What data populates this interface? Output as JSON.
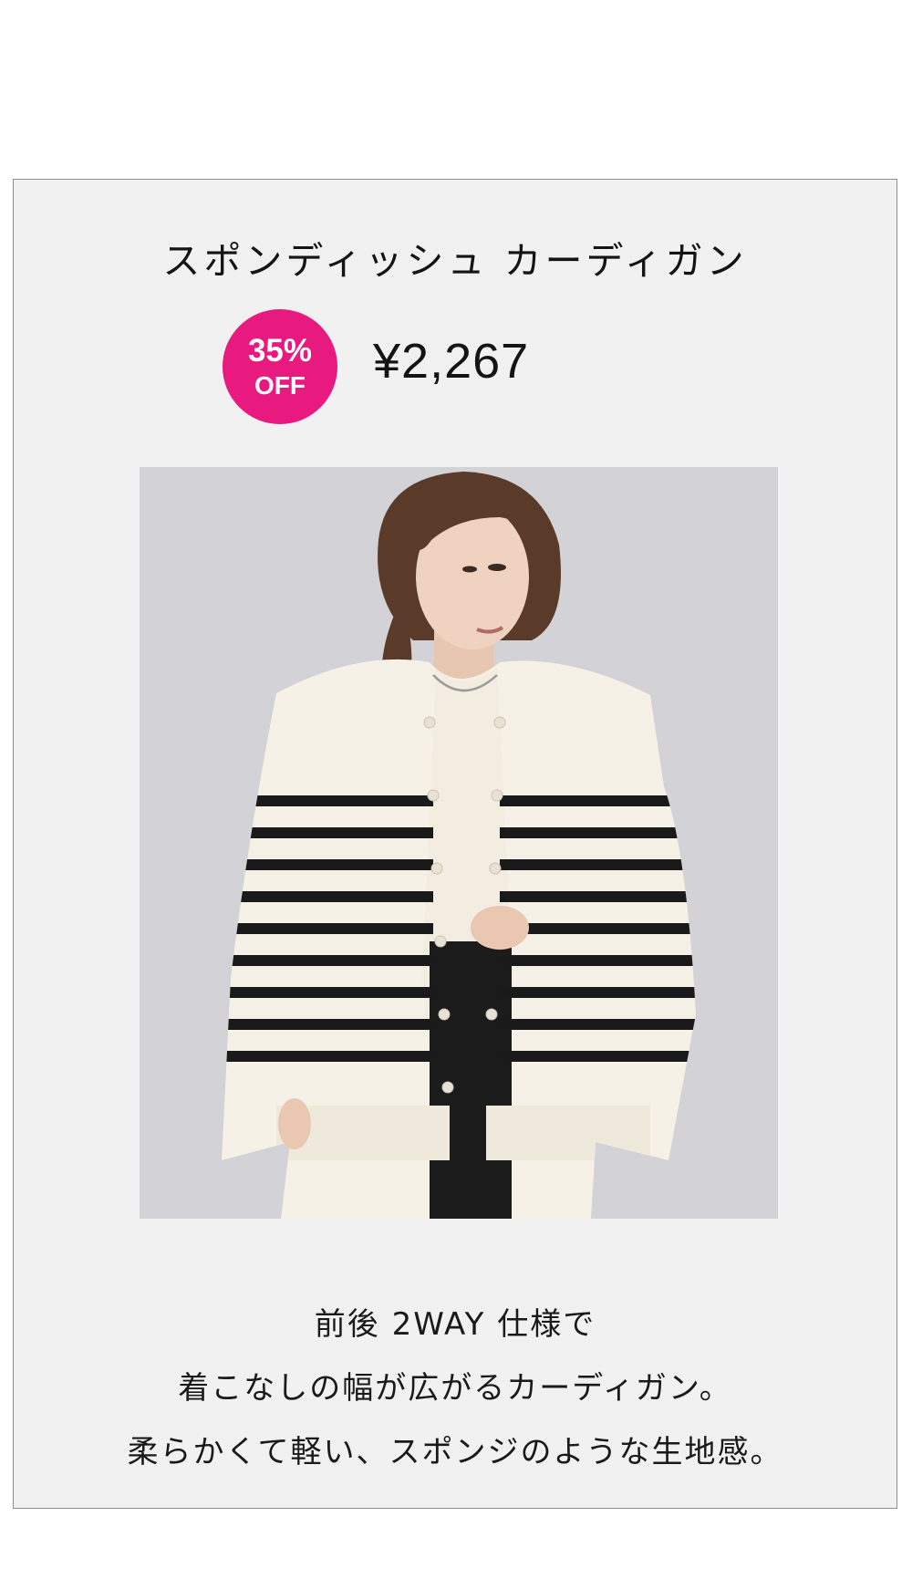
{
  "product": {
    "title": "スポンディッシュ カーディガン",
    "discount": {
      "percent": "35%",
      "label": "OFF",
      "color": "#e8197f"
    },
    "price": "¥2,267",
    "image": {
      "icon": "product-photo-striped-cardigan"
    },
    "description": [
      "前後 2WAY 仕様で",
      "着こなしの幅が広がるカーディガン。",
      "柔らかくて軽い、スポンジのような生地感。"
    ]
  }
}
